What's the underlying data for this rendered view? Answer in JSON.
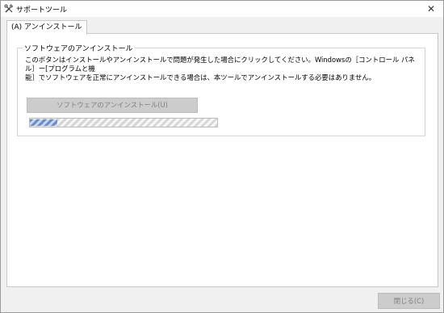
{
  "window": {
    "title": "サポートツール",
    "close_glyph": "✕",
    "icon": "tools-icon"
  },
  "tabs": [
    {
      "label": "(A) アンインストール",
      "selected": true
    }
  ],
  "uninstall_group": {
    "title": "ソフトウェアのアンインストール",
    "description_line1": "このボタンはインストールやアンインストールで問題が発生した場合にクリックしてください。Windowsの［コントロール パネル］ー[プログラムと機",
    "description_line2": "能］でソフトウェアを正常にアンインストールできる場合は、本ツールでアンインストールする必要はありません。",
    "button_label": "ソフトウェアのアンインストール(U)",
    "button_enabled": false,
    "progress_state": "marquee"
  },
  "footer": {
    "close_label": "閉じる(C)",
    "close_enabled": false
  },
  "colors": {
    "window_bg": "#f0f0f0",
    "panel_bg": "#ffffff",
    "disabled_button": "#cccccc",
    "progress_accent": "#6f8dc9"
  }
}
